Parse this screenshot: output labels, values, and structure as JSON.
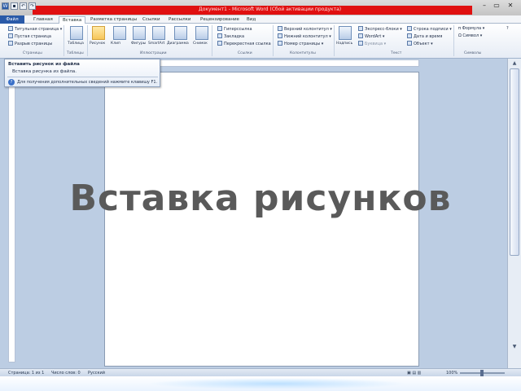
{
  "window": {
    "title": "Документ1 - Microsoft Word (Сбой активации продукта)",
    "qat_icons": [
      "word-icon",
      "save-icon",
      "undo-icon",
      "redo-icon"
    ],
    "controls": [
      "–",
      "▭",
      "✕"
    ]
  },
  "tabs": {
    "file": "Файл",
    "items": [
      "Главная",
      "Вставка",
      "Разметка страницы",
      "Ссылки",
      "Рассылки",
      "Рецензирование",
      "Вид"
    ],
    "active_index": 1
  },
  "ribbon": {
    "pages_group": {
      "items": [
        "Титульная страница ▾",
        "Пустая страница",
        "Разрыв страницы"
      ],
      "label": "Страницы"
    },
    "tables_group": {
      "button": "Таблица",
      "label": "Таблицы"
    },
    "illustrations_group": {
      "buttons": [
        "Рисунок",
        "Клип",
        "Фигуры",
        "SmartArt",
        "Диаграмма",
        "Снимок"
      ],
      "label": "Иллюстрации"
    },
    "links_group": {
      "items": [
        "Гиперссылка",
        "Закладка",
        "Перекрестная ссылка"
      ],
      "label": "Ссылки"
    },
    "header_footer_group": {
      "items": [
        "Верхний колонтитул ▾",
        "Нижний колонтитул ▾",
        "Номер страницы ▾"
      ],
      "label": "Колонтитулы"
    },
    "text_group": {
      "button": "Надпись",
      "items": [
        "Экспресс-блоки ▾",
        "WordArt ▾",
        "Буквица ▾",
        "Строка подписи ▾",
        "Дата и время",
        "Объект ▾"
      ],
      "label": "Текст"
    },
    "symbols_group": {
      "items": [
        "Формула ▾",
        "Символ ▾"
      ],
      "label": "Символы"
    }
  },
  "tooltip": {
    "title": "Вставить рисунок из файла",
    "body": "Вставка рисунка из файла.",
    "help": "Для получения дополнительных сведений нажмите клавишу F1."
  },
  "statusbar": {
    "page": "Страница: 1 из 1",
    "words": "Число слов: 0",
    "language": "Русский",
    "zoom": "100%"
  },
  "slide": {
    "title": "Вставка рисунков"
  },
  "colors": {
    "title_red": "#e01010",
    "file_tab": "#2a5aa8",
    "workarea": "#bccde3",
    "heading": "#5a5a5a"
  }
}
